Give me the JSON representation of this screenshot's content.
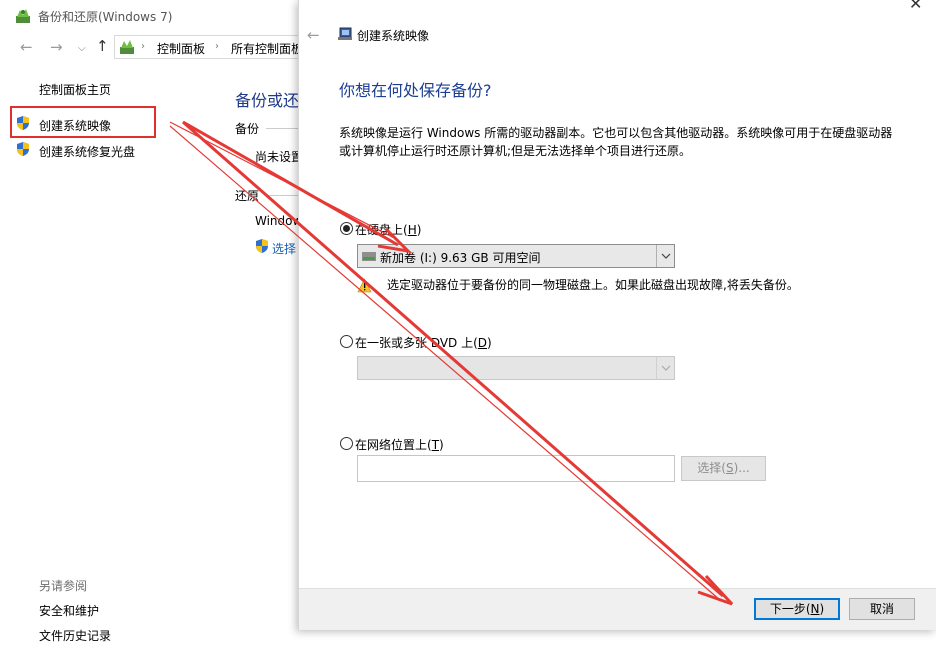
{
  "window": {
    "title": "备份和还原(Windows 7)",
    "breadcrumb": [
      "控制面板",
      "所有控制面板"
    ]
  },
  "sidebar": {
    "home": "控制面板主页",
    "items": [
      {
        "label": "创建系统映像"
      },
      {
        "label": "创建系统修复光盘"
      }
    ],
    "see_also_title": "另请参阅",
    "see_also": [
      "安全和维护",
      "文件历史记录"
    ]
  },
  "main": {
    "heading": "备份或还",
    "backup_label": "备份",
    "backup_status": "尚未设置",
    "restore_label": "还原",
    "restore_text": "Window",
    "restore_link": "选择"
  },
  "dialog": {
    "title": "创建系统映像",
    "heading": "你想在何处保存备份?",
    "description": "系统映像是运行 Windows 所需的驱动器副本。它也可以包含其他驱动器。系统映像可用于在硬盘驱动器或计算机停止运行时还原计算机;但是无法选择单个项目进行还原。",
    "option_hdd": {
      "label_prefix": "在硬盘上(",
      "accel": "H",
      "label_suffix": ")",
      "selected": true
    },
    "drive_select_value": "新加卷 (I:)  9.63 GB 可用空间",
    "warning": "选定驱动器位于要备份的同一物理磁盘上。如果此磁盘出现故障,将丢失备份。",
    "option_dvd": {
      "label_prefix": "在一张或多张 DVD 上(",
      "accel": "D",
      "label_suffix": ")",
      "selected": false
    },
    "option_network": {
      "label_prefix": "在网络位置上(",
      "accel": "T",
      "label_suffix": ")",
      "selected": false
    },
    "network_path_value": "",
    "select_button": {
      "prefix": "选择(",
      "accel": "S",
      "suffix": ")..."
    },
    "next_button": {
      "prefix": "下一步(",
      "accel": "N",
      "suffix": ")"
    },
    "cancel_button": "取消"
  },
  "annotation": {
    "color": "#e53935"
  },
  "icons": [
    "app-icon",
    "back-arrow-icon",
    "forward-arrow-icon",
    "up-arrow-icon",
    "control-panel-icon",
    "shield-icon",
    "close-icon",
    "drive-icon",
    "warning-icon",
    "chevron-down-icon"
  ]
}
